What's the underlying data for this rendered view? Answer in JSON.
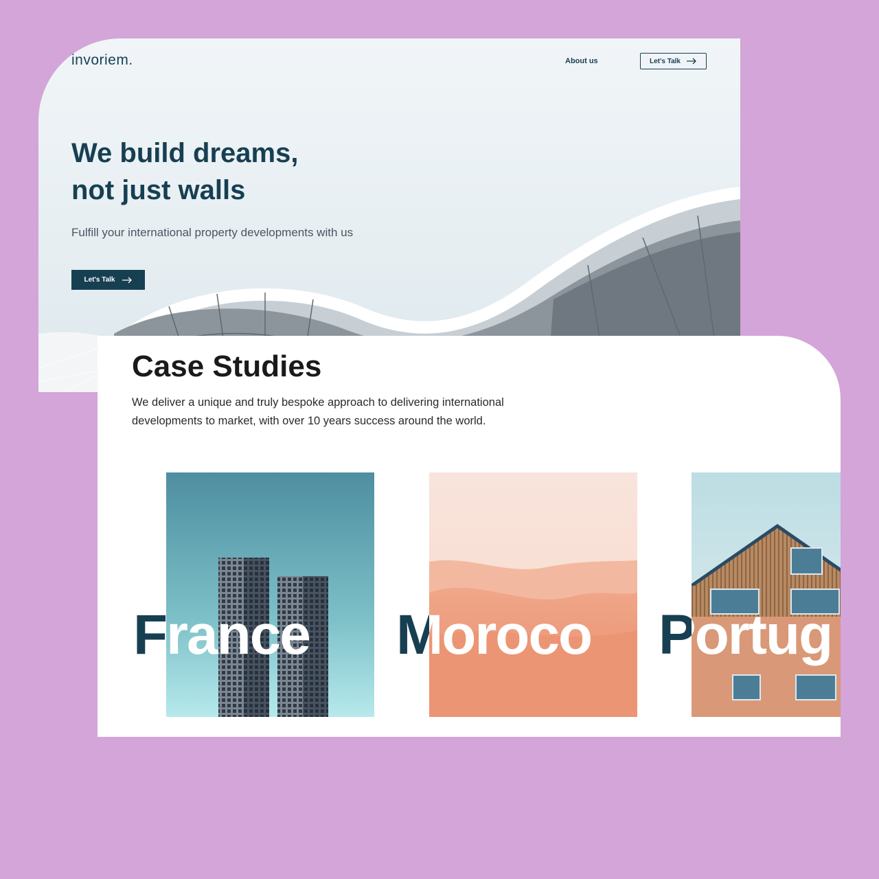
{
  "header": {
    "logo": "invoriem.",
    "nav_about": "About us",
    "nav_cta": "Let's Talk"
  },
  "hero": {
    "title_line1": "We build dreams,",
    "title_line2": "not just walls",
    "subtitle": "Fulfill your international property developments with us",
    "cta": "Let's Talk"
  },
  "case_studies": {
    "title": "Case Studies",
    "description_line1": "We deliver a unique and truly bespoke approach to delivering international",
    "description_line2": "developments to market, with over 10 years success around the world.",
    "items": [
      {
        "label": "France"
      },
      {
        "label": "Moroco"
      },
      {
        "label": "Portug"
      }
    ]
  },
  "colors": {
    "background": "#d3a5d8",
    "brand_navy": "#173f52",
    "text_dark": "#1a1a1a"
  },
  "icons": [
    "arrow-right-icon"
  ]
}
